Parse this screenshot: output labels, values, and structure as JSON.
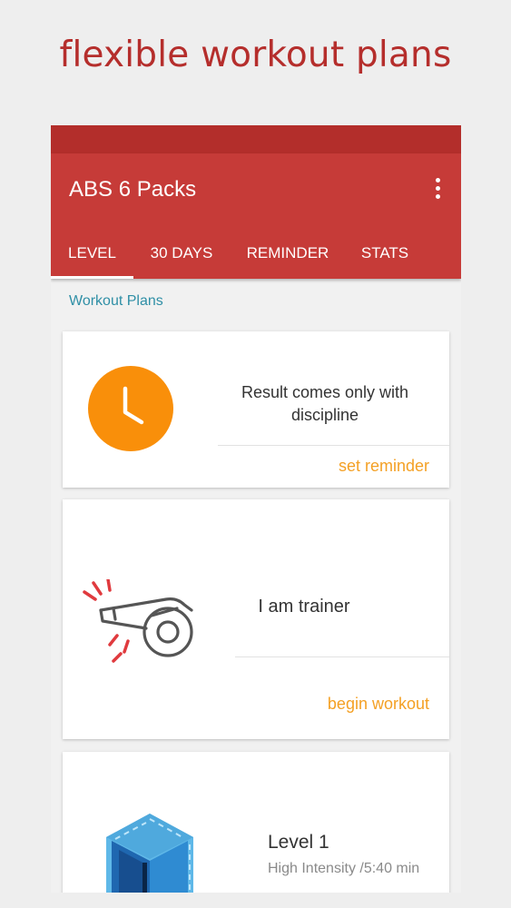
{
  "headline": "flexible workout plans",
  "app": {
    "title": "ABS 6 Packs",
    "tabs": [
      {
        "label": "LEVEL"
      },
      {
        "label": "30 DAYS"
      },
      {
        "label": "REMINDER"
      },
      {
        "label": "STATS"
      }
    ],
    "active_tab": "LEVEL"
  },
  "section_label": "Workout Plans",
  "cards": [
    {
      "text": "Result comes only with discipline",
      "action": "set reminder",
      "icon": "clock-icon"
    },
    {
      "text": "I am trainer",
      "action": "begin workout",
      "icon": "whistle-icon"
    },
    {
      "title": "Level 1",
      "subtitle": "High Intensity /5:40 min",
      "icon": "cube-icon"
    }
  ],
  "colors": {
    "brand_red": "#c63b38",
    "status_red": "#b32e2b",
    "headline_red": "#b52e2c",
    "accent_orange": "#f4a024",
    "clock_orange": "#f98f0a",
    "link_teal": "#2f8fa6"
  }
}
